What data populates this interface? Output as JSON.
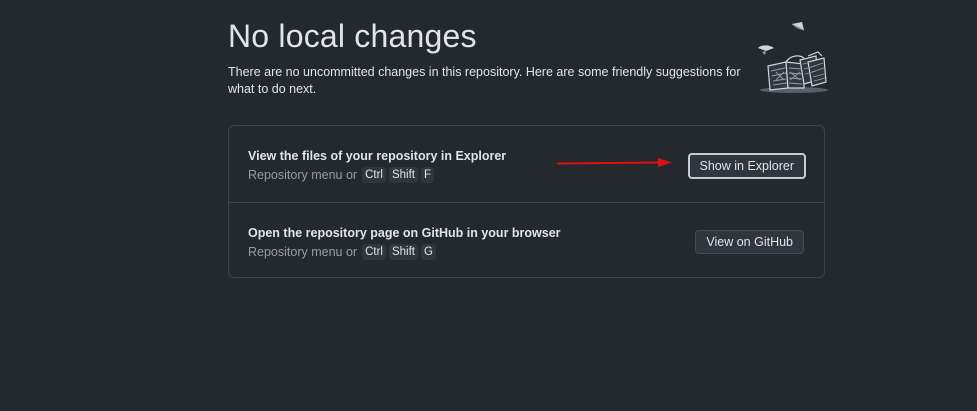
{
  "header": {
    "title": "No local changes",
    "subtitle": "There are no uncommitted changes in this repository. Here are some friendly suggestions for what to do next."
  },
  "illustration": {
    "icon": "empty-repo-illustration-icon"
  },
  "suggestions": [
    {
      "title": "View the files of your repository in Explorer",
      "hint_prefix": "Repository menu or",
      "keys": [
        "Ctrl",
        "Shift",
        "F"
      ],
      "button_label": "Show in Explorer"
    },
    {
      "title": "Open the repository page on GitHub in your browser",
      "hint_prefix": "Repository menu or",
      "keys": [
        "Ctrl",
        "Shift",
        "G"
      ],
      "button_label": "View on GitHub"
    }
  ],
  "annotation": {
    "color": "#e01010"
  }
}
